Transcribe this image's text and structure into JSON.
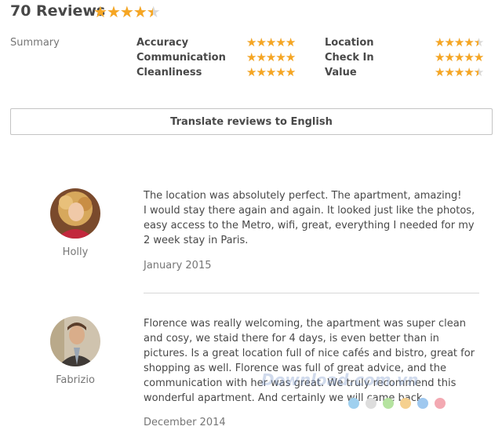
{
  "header": {
    "title": "70 Reviews",
    "overall_rating": 4.5
  },
  "summary": {
    "label": "Summary",
    "categories": [
      {
        "name": "Accuracy",
        "rating": 5
      },
      {
        "name": "Communication",
        "rating": 5
      },
      {
        "name": "Cleanliness",
        "rating": 5
      },
      {
        "name": "Location",
        "rating": 4.5
      },
      {
        "name": "Check In",
        "rating": 5
      },
      {
        "name": "Value",
        "rating": 4.5
      }
    ]
  },
  "translate_button": {
    "label": "Translate reviews to English"
  },
  "reviews": [
    {
      "name": "Holly",
      "text": "The location was absolutely perfect. The apartment, amazing!\nI would stay there again and again. It looked just like the photos, easy access to the Metro, wifi, great, everything I needed for my 2 week stay in Paris.",
      "date": "January 2015"
    },
    {
      "name": "Fabrizio",
      "text": "Florence was really welcoming, the apartment was super clean and cosy, we staid there for 4 days, is even better than in pictures. Is a great location full of nice cafés and bistro, great for shopping as well. Florence was full of great advice, and the communication with her was great. We truly recommend this wonderful apartment. And certainly we will came back.",
      "date": "December 2014"
    }
  ],
  "watermark": {
    "text": "Download.com.vn"
  },
  "colors": {
    "star": "#f6a623",
    "star_empty": "#d9d9d9",
    "text": "#484848",
    "muted": "#767676"
  }
}
